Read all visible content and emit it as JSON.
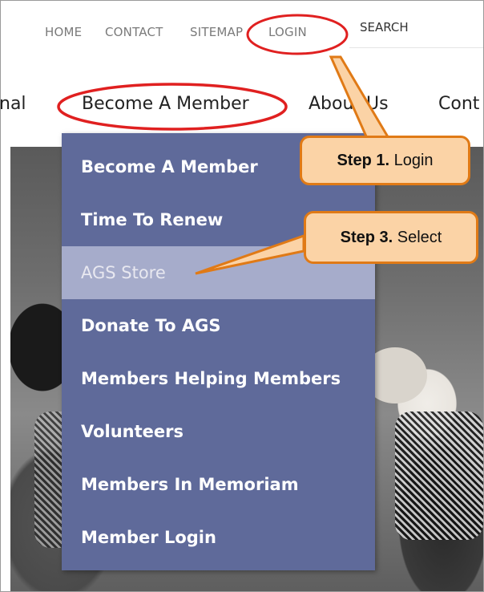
{
  "topbar": {
    "links": [
      "HOME",
      "CONTACT",
      "SITEMAP",
      "LOGIN"
    ],
    "search_label": "SEARCH"
  },
  "nav": {
    "items": [
      "nal",
      "Become A Member",
      "About Us",
      "Cont"
    ]
  },
  "dropdown": {
    "items": [
      "Become A Member",
      "Time To Renew",
      "AGS Store",
      "Donate To AGS",
      "Members Helping Members",
      "Volunteers",
      "Members In Memoriam",
      "Member Login"
    ],
    "active_item": "AGS Store"
  },
  "callouts": {
    "step1_bold": "Step 1.",
    "step1_text": " Login",
    "step3_bold": "Step 3.",
    "step3_text": " Select"
  },
  "colors": {
    "dropdown_bg": "#5f6a9a",
    "dropdown_active_bg": "#a6accb",
    "callout_fill": "#fbd3a6",
    "callout_border": "#e07a16",
    "highlight_ellipse": "#e02020"
  }
}
